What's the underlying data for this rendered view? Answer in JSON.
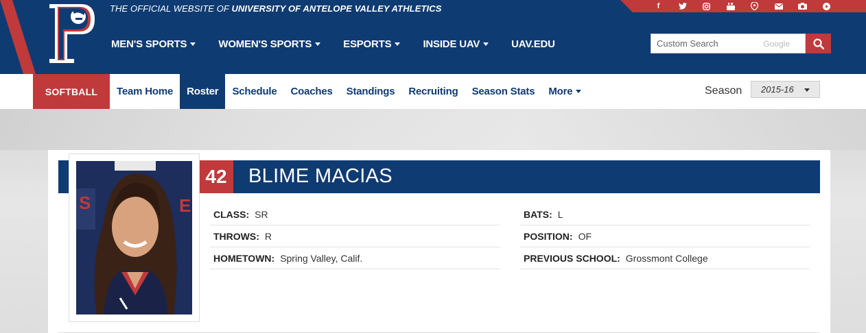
{
  "header": {
    "tagline_prefix": "THE OFFICIAL WEBSITE OF",
    "tagline_org": "UNIVERSITY OF ANTELOPE VALLEY ATHLETICS",
    "logo": "pioneer-p-logo",
    "social_icons": [
      "facebook-icon",
      "twitter-icon",
      "instagram-icon",
      "youtube-icon",
      "periscope-icon",
      "mail-icon",
      "camera-icon",
      "play-icon"
    ],
    "nav": [
      {
        "label": "MEN'S SPORTS",
        "dropdown": true
      },
      {
        "label": "WOMEN'S SPORTS",
        "dropdown": true
      },
      {
        "label": "ESPORTS",
        "dropdown": true
      },
      {
        "label": "INSIDE UAV",
        "dropdown": true
      },
      {
        "label": "UAV.EDU",
        "dropdown": false
      }
    ],
    "search": {
      "placeholder": "Custom Search",
      "brand": "Google",
      "button_icon": "search-icon"
    }
  },
  "subnav": {
    "sport": "SOFTBALL",
    "links": [
      {
        "label": "Team Home",
        "active": false
      },
      {
        "label": "Roster",
        "active": true
      },
      {
        "label": "Schedule",
        "active": false
      },
      {
        "label": "Coaches",
        "active": false
      },
      {
        "label": "Standings",
        "active": false
      },
      {
        "label": "Recruiting",
        "active": false
      },
      {
        "label": "Season Stats",
        "active": false
      },
      {
        "label": "More",
        "active": false,
        "dropdown": true
      }
    ],
    "season_label": "Season",
    "season_value": "2015-16"
  },
  "player": {
    "number": "42",
    "name": "BLIME MACIAS",
    "bio_left": [
      {
        "label": "CLASS:",
        "value": "SR"
      },
      {
        "label": "THROWS:",
        "value": "R"
      },
      {
        "label": "HOMETOWN:",
        "value": "Spring Valley, Calif."
      }
    ],
    "bio_right": [
      {
        "label": "BATS:",
        "value": "L"
      },
      {
        "label": "POSITION:",
        "value": "OF"
      },
      {
        "label": "PREVIOUS SCHOOL:",
        "value": "Grossmont College"
      }
    ]
  },
  "colors": {
    "navy": "#0f3b73",
    "red": "#c0393b"
  }
}
